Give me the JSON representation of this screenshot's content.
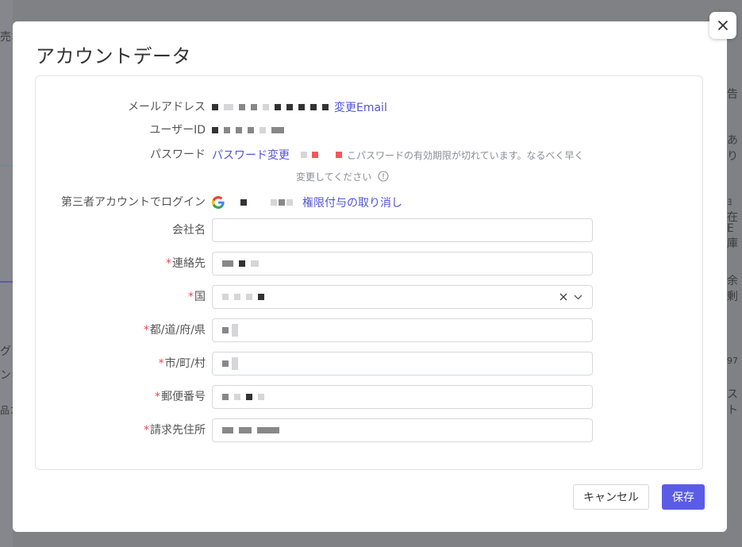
{
  "background": {
    "fragments": [
      "売ホ",
      "告 ",
      "あり",
      "ｮ在",
      "E庫",
      "余剰",
      "グ",
      "ンキ",
      "品コ",
      "97",
      "スト"
    ]
  },
  "dialog": {
    "title": "アカウントデータ",
    "close_icon": "close-icon"
  },
  "account": {
    "email_label": "メールアドレス",
    "email_change_link": "変更Email",
    "user_id_label": "ユーザーID",
    "password_label": "パスワード",
    "password_change_link": "パスワード変更",
    "password_hint_line1": "こパスワードの有効期限が切れています。なるべく早く",
    "password_hint_line2": "変更してください",
    "third_party_label": "第三者アカウントでログイン",
    "third_party_icon": "google-icon",
    "revoke_link": "権限付与の取り消し"
  },
  "form": {
    "company_label": "会社名",
    "company_value": "",
    "contact_label": "連絡先",
    "country_label": "国",
    "prefecture_label": "都/道/府/県",
    "city_label": "市/町/村",
    "postal_label": "郵便番号",
    "billing_address_label": "請求先住所",
    "required_mark": "*"
  },
  "footer": {
    "cancel_label": "キャンセル",
    "save_label": "保存"
  },
  "colors": {
    "accent": "#5b5ce6",
    "link": "#5154d8",
    "required": "#e5484d"
  }
}
